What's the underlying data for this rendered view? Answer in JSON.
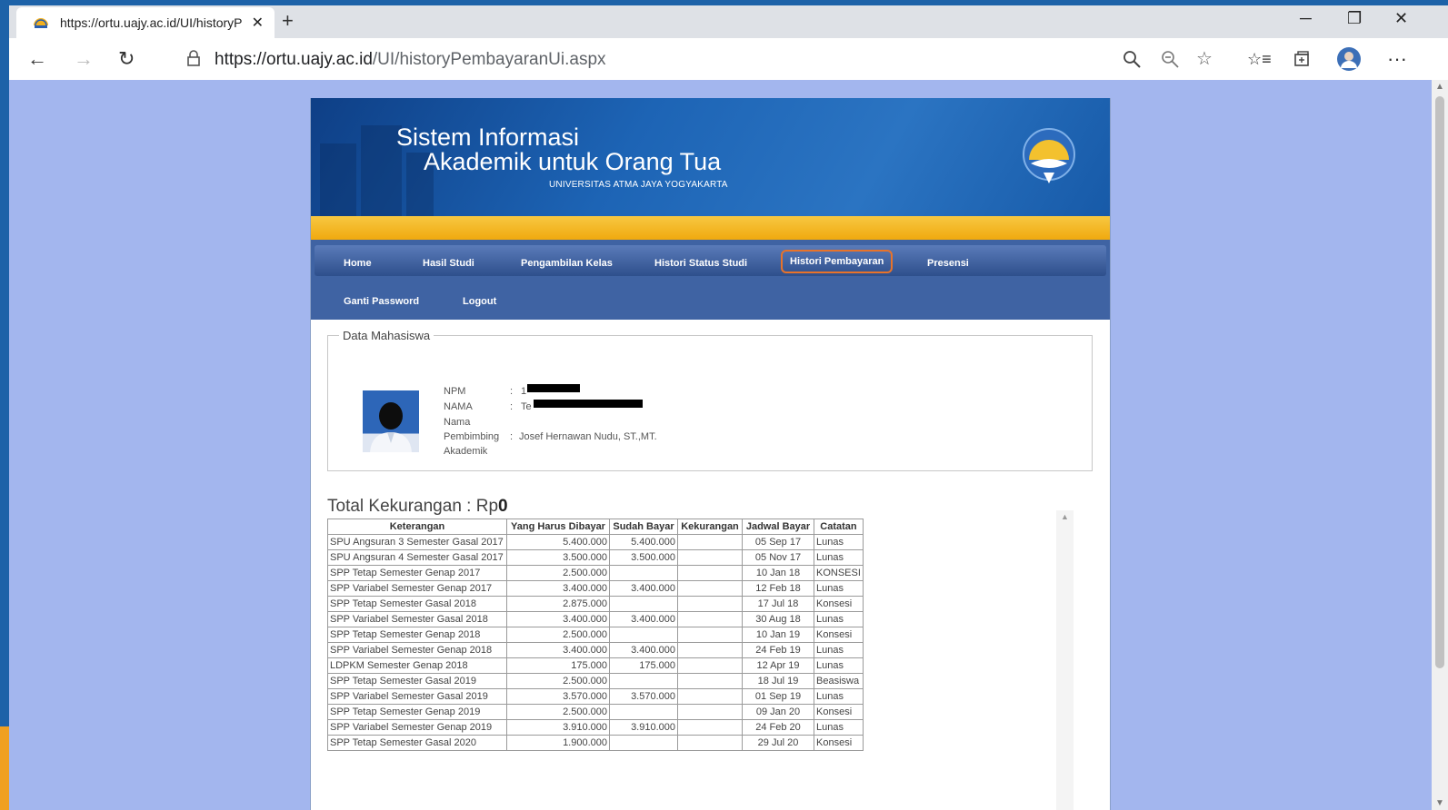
{
  "browser": {
    "tab_title": "https://ortu.uajy.ac.id/UI/historyP",
    "tab_close": "✕",
    "new_tab": "+",
    "url_host": "https://ortu.uajy.ac.id",
    "url_path": "/UI/historyPembayaranUi.aspx",
    "controls": {
      "minimize": "─",
      "restore": "❐",
      "close": "✕"
    },
    "icons": [
      "back-icon",
      "forward-icon",
      "refresh-icon",
      "lock-icon",
      "search-icon",
      "zoom-out-icon",
      "favorite-star-icon",
      "favorites-list-icon",
      "collections-icon",
      "profile-avatar",
      "more-icon"
    ]
  },
  "banner": {
    "line1": "Sistem Informasi",
    "line2": "Akademik untuk Orang Tua",
    "subtitle": "UNIVERSITAS ATMA JAYA YOGYAKARTA"
  },
  "menu": {
    "home": "Home",
    "hasil_studi": "Hasil Studi",
    "pengambilan_kelas": "Pengambilan Kelas",
    "histori_status": "Histori Status Studi",
    "histori_pembayaran": "Histori Pembayaran",
    "presensi": "Presensi",
    "ganti_password": "Ganti Password",
    "logout": "Logout"
  },
  "student": {
    "legend": "Data Mahasiswa",
    "npm_label": "NPM",
    "npm_value": "1",
    "nama_label": "NAMA",
    "nama_value": "Te",
    "nama2_label": "Nama",
    "pembimbing_label": "Pembimbing",
    "akademik_label": "Akademik",
    "pembimbing_value": "Josef Hernawan Nudu, ST.,MT.",
    "sep": ":"
  },
  "total": {
    "label": "Total Kekurangan : Rp",
    "value": "0"
  },
  "payments": {
    "headers": [
      "Keterangan",
      "Yang Harus Dibayar",
      "Sudah Bayar",
      "Kekurangan",
      "Jadwal Bayar",
      "Catatan"
    ],
    "rows": [
      [
        "SPU Angsuran 3 Semester Gasal 2017",
        "5.400.000",
        "5.400.000",
        "",
        "05 Sep 17",
        "Lunas"
      ],
      [
        "SPU Angsuran 4 Semester Gasal 2017",
        "3.500.000",
        "3.500.000",
        "",
        "05 Nov 17",
        "Lunas"
      ],
      [
        "SPP Tetap Semester Genap 2017",
        "2.500.000",
        "",
        "",
        "10 Jan 18",
        "KONSESI"
      ],
      [
        "SPP Variabel Semester Genap 2017",
        "3.400.000",
        "3.400.000",
        "",
        "12 Feb 18",
        "Lunas"
      ],
      [
        "SPP Tetap Semester Gasal 2018",
        "2.875.000",
        "",
        "",
        "17 Jul 18",
        "Konsesi"
      ],
      [
        "SPP Variabel Semester Gasal 2018",
        "3.400.000",
        "3.400.000",
        "",
        "30 Aug 18",
        "Lunas"
      ],
      [
        "SPP Tetap Semester Genap 2018",
        "2.500.000",
        "",
        "",
        "10 Jan 19",
        "Konsesi"
      ],
      [
        "SPP Variabel Semester Genap 2018",
        "3.400.000",
        "3.400.000",
        "",
        "24 Feb 19",
        "Lunas"
      ],
      [
        "LDPKM Semester Genap 2018",
        "175.000",
        "175.000",
        "",
        "12 Apr 19",
        "Lunas"
      ],
      [
        "SPP Tetap Semester Gasal 2019",
        "2.500.000",
        "",
        "",
        "18 Jul 19",
        "Beasiswa"
      ],
      [
        "SPP Variabel Semester Gasal 2019",
        "3.570.000",
        "3.570.000",
        "",
        "01 Sep 19",
        "Lunas"
      ],
      [
        "SPP Tetap Semester Genap 2019",
        "2.500.000",
        "",
        "",
        "09 Jan 20",
        "Konsesi"
      ],
      [
        "SPP Variabel Semester Genap 2019",
        "3.910.000",
        "3.910.000",
        "",
        "24 Feb 20",
        "Lunas"
      ],
      [
        "SPP Tetap Semester Gasal 2020",
        "1.900.000",
        "",
        "",
        "29 Jul 20",
        "Konsesi"
      ]
    ]
  },
  "colors": {
    "banner_blue": "#1d64b5",
    "gold_bar": "#f0a90e",
    "menu_blue": "#3f63a3",
    "active_outline": "#e8732a",
    "page_bg": "#a3b6ee"
  }
}
